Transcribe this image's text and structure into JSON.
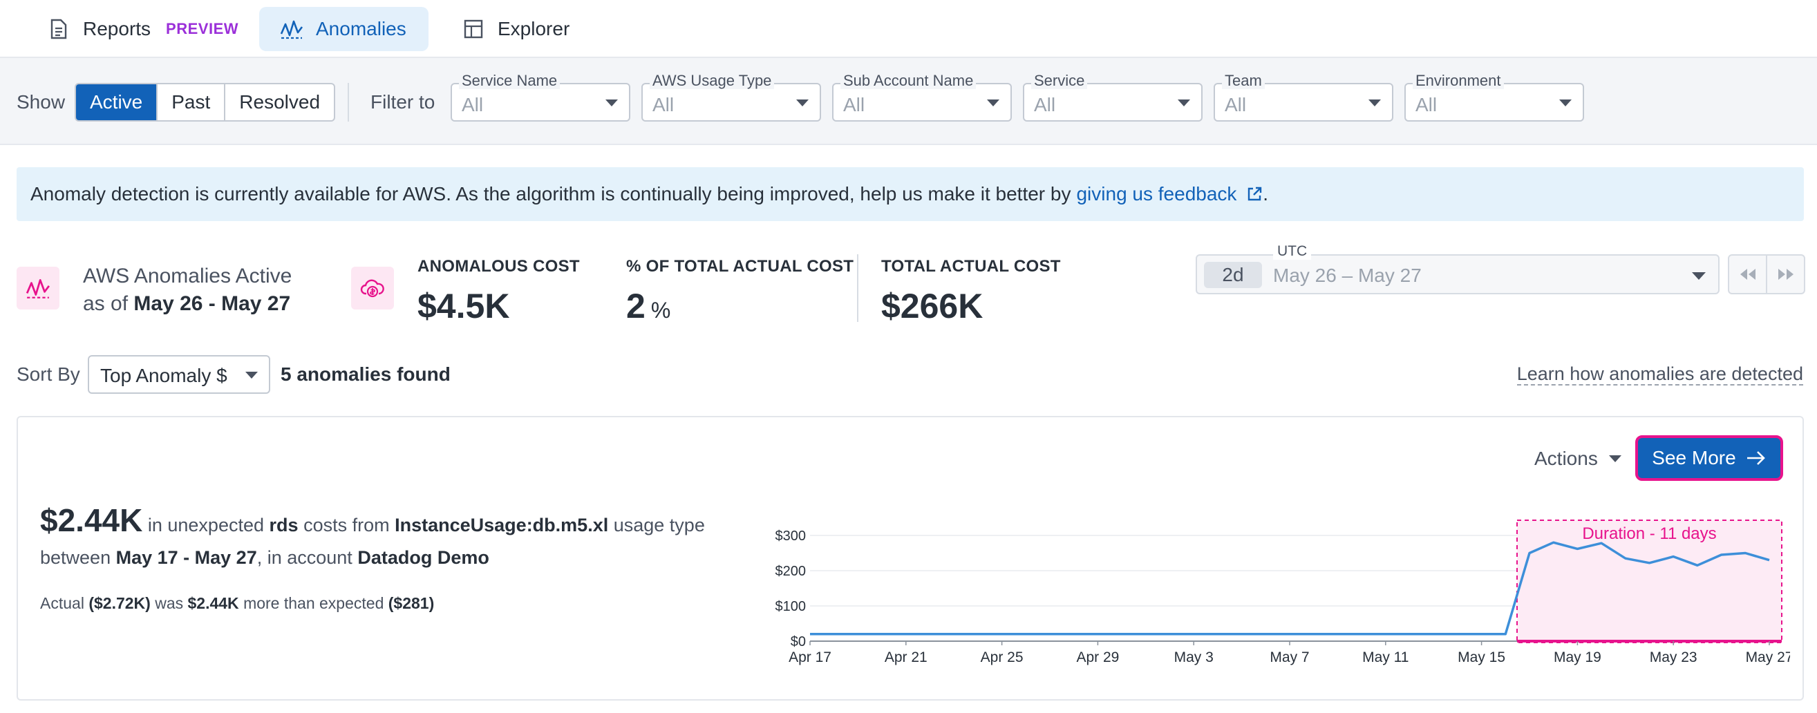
{
  "tabs": {
    "reports": "Reports",
    "reports_badge": "PREVIEW",
    "anomalies": "Anomalies",
    "explorer": "Explorer"
  },
  "filters": {
    "show_label": "Show",
    "show_options": [
      "Active",
      "Past",
      "Resolved"
    ],
    "show_selected": "Active",
    "filter_to_label": "Filter to",
    "dropdowns": [
      {
        "title": "Service Name",
        "value": "All"
      },
      {
        "title": "AWS Usage Type",
        "value": "All"
      },
      {
        "title": "Sub Account Name",
        "value": "All"
      },
      {
        "title": "Service",
        "value": "All"
      },
      {
        "title": "Team",
        "value": "All"
      },
      {
        "title": "Environment",
        "value": "All"
      }
    ]
  },
  "banner": {
    "text": "Anomaly detection is currently available for AWS. As the algorithm is continually being improved, help us make it better by",
    "link": "giving us feedback",
    "suffix": "."
  },
  "summary": {
    "title": "AWS Anomalies Active",
    "asof_prefix": "as of",
    "asof_range": "May 26 - May 27",
    "anomalous_cost_label": "ANOMALOUS COST",
    "anomalous_cost_value": "$4.5K",
    "pct_label": "% OF TOTAL ACTUAL COST",
    "pct_value": "2",
    "pct_unit": "%",
    "total_label": "TOTAL ACTUAL COST",
    "total_value": "$266K"
  },
  "datepicker": {
    "tz": "UTC",
    "chip": "2d",
    "range": "May 26 – May 27"
  },
  "sort": {
    "label": "Sort By",
    "value": "Top Anomaly $",
    "found": "5 anomalies found",
    "learn_link": "Learn how anomalies are detected"
  },
  "card": {
    "actions": "Actions",
    "see_more": "See More",
    "amount": "$2.44K",
    "t1": "in unexpected",
    "service": "rds",
    "t2": "costs from",
    "usage_type": "InstanceUsage:db.m5.xl",
    "t3": "usage type",
    "t4": "between",
    "period": "May 17 - May 27",
    "t5": ", in account",
    "account": "Datadog Demo",
    "actual_prefix": "Actual",
    "actual": "($2.72K)",
    "was": "was",
    "diff": "$2.44K",
    "more_than": "more than expected",
    "expected": "($281)"
  },
  "chart_data": {
    "type": "line",
    "duration_label": "Duration - 11 days",
    "x_ticks": [
      "Apr 17",
      "Apr 21",
      "Apr 25",
      "Apr 29",
      "May 3",
      "May 7",
      "May 11",
      "May 15",
      "May 19",
      "May 23",
      "May 27"
    ],
    "y_ticks": [
      "$0",
      "$100",
      "$200",
      "$300"
    ],
    "ylim": [
      0,
      300
    ],
    "series": [
      {
        "color": "#3d8fd9",
        "x": [
          "Apr 17",
          "Apr 18",
          "Apr 19",
          "Apr 20",
          "Apr 21",
          "Apr 22",
          "Apr 23",
          "Apr 24",
          "Apr 25",
          "Apr 26",
          "Apr 27",
          "Apr 28",
          "Apr 29",
          "Apr 30",
          "May 1",
          "May 2",
          "May 3",
          "May 4",
          "May 5",
          "May 6",
          "May 7",
          "May 8",
          "May 9",
          "May 10",
          "May 11",
          "May 12",
          "May 13",
          "May 14",
          "May 15",
          "May 16",
          "May 17",
          "May 18",
          "May 19",
          "May 20",
          "May 21",
          "May 22",
          "May 23",
          "May 24",
          "May 25",
          "May 26",
          "May 27"
        ],
        "values": [
          20,
          20,
          20,
          20,
          20,
          20,
          20,
          20,
          20,
          20,
          20,
          20,
          20,
          20,
          20,
          20,
          20,
          20,
          20,
          20,
          20,
          20,
          20,
          20,
          20,
          20,
          20,
          20,
          20,
          20,
          250,
          280,
          262,
          278,
          235,
          222,
          240,
          215,
          245,
          250,
          230
        ]
      }
    ],
    "anomaly_start": "May 17",
    "anomaly_end": "May 27",
    "highlight_color": "#e7138c"
  }
}
